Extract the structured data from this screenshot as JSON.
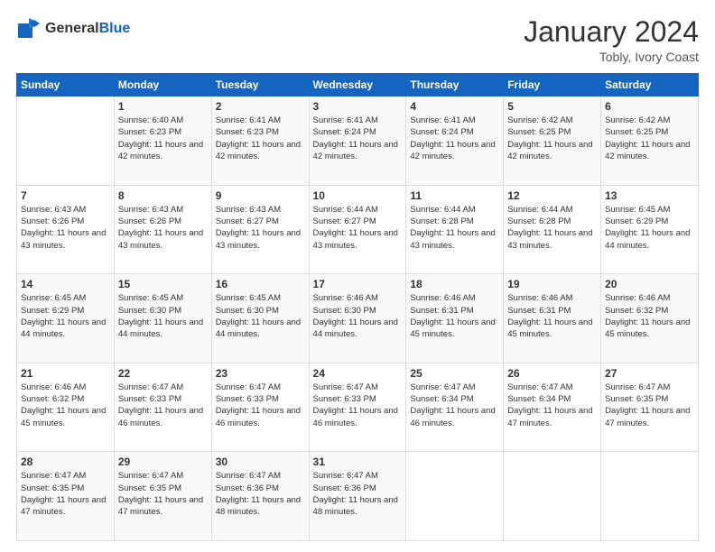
{
  "header": {
    "logo_general": "General",
    "logo_blue": "Blue",
    "month_title": "January 2024",
    "location": "Tobly, Ivory Coast"
  },
  "weekdays": [
    "Sunday",
    "Monday",
    "Tuesday",
    "Wednesday",
    "Thursday",
    "Friday",
    "Saturday"
  ],
  "weeks": [
    [
      {
        "day": "",
        "sunrise": "",
        "sunset": "",
        "daylight": ""
      },
      {
        "day": "1",
        "sunrise": "6:40 AM",
        "sunset": "6:23 PM",
        "daylight": "11 hours and 42 minutes."
      },
      {
        "day": "2",
        "sunrise": "6:41 AM",
        "sunset": "6:23 PM",
        "daylight": "11 hours and 42 minutes."
      },
      {
        "day": "3",
        "sunrise": "6:41 AM",
        "sunset": "6:24 PM",
        "daylight": "11 hours and 42 minutes."
      },
      {
        "day": "4",
        "sunrise": "6:41 AM",
        "sunset": "6:24 PM",
        "daylight": "11 hours and 42 minutes."
      },
      {
        "day": "5",
        "sunrise": "6:42 AM",
        "sunset": "6:25 PM",
        "daylight": "11 hours and 42 minutes."
      },
      {
        "day": "6",
        "sunrise": "6:42 AM",
        "sunset": "6:25 PM",
        "daylight": "11 hours and 42 minutes."
      }
    ],
    [
      {
        "day": "7",
        "sunrise": "6:43 AM",
        "sunset": "6:26 PM",
        "daylight": "11 hours and 43 minutes."
      },
      {
        "day": "8",
        "sunrise": "6:43 AM",
        "sunset": "6:26 PM",
        "daylight": "11 hours and 43 minutes."
      },
      {
        "day": "9",
        "sunrise": "6:43 AM",
        "sunset": "6:27 PM",
        "daylight": "11 hours and 43 minutes."
      },
      {
        "day": "10",
        "sunrise": "6:44 AM",
        "sunset": "6:27 PM",
        "daylight": "11 hours and 43 minutes."
      },
      {
        "day": "11",
        "sunrise": "6:44 AM",
        "sunset": "6:28 PM",
        "daylight": "11 hours and 43 minutes."
      },
      {
        "day": "12",
        "sunrise": "6:44 AM",
        "sunset": "6:28 PM",
        "daylight": "11 hours and 43 minutes."
      },
      {
        "day": "13",
        "sunrise": "6:45 AM",
        "sunset": "6:29 PM",
        "daylight": "11 hours and 44 minutes."
      }
    ],
    [
      {
        "day": "14",
        "sunrise": "6:45 AM",
        "sunset": "6:29 PM",
        "daylight": "11 hours and 44 minutes."
      },
      {
        "day": "15",
        "sunrise": "6:45 AM",
        "sunset": "6:30 PM",
        "daylight": "11 hours and 44 minutes."
      },
      {
        "day": "16",
        "sunrise": "6:45 AM",
        "sunset": "6:30 PM",
        "daylight": "11 hours and 44 minutes."
      },
      {
        "day": "17",
        "sunrise": "6:46 AM",
        "sunset": "6:30 PM",
        "daylight": "11 hours and 44 minutes."
      },
      {
        "day": "18",
        "sunrise": "6:46 AM",
        "sunset": "6:31 PM",
        "daylight": "11 hours and 45 minutes."
      },
      {
        "day": "19",
        "sunrise": "6:46 AM",
        "sunset": "6:31 PM",
        "daylight": "11 hours and 45 minutes."
      },
      {
        "day": "20",
        "sunrise": "6:46 AM",
        "sunset": "6:32 PM",
        "daylight": "11 hours and 45 minutes."
      }
    ],
    [
      {
        "day": "21",
        "sunrise": "6:46 AM",
        "sunset": "6:32 PM",
        "daylight": "11 hours and 45 minutes."
      },
      {
        "day": "22",
        "sunrise": "6:47 AM",
        "sunset": "6:33 PM",
        "daylight": "11 hours and 46 minutes."
      },
      {
        "day": "23",
        "sunrise": "6:47 AM",
        "sunset": "6:33 PM",
        "daylight": "11 hours and 46 minutes."
      },
      {
        "day": "24",
        "sunrise": "6:47 AM",
        "sunset": "6:33 PM",
        "daylight": "11 hours and 46 minutes."
      },
      {
        "day": "25",
        "sunrise": "6:47 AM",
        "sunset": "6:34 PM",
        "daylight": "11 hours and 46 minutes."
      },
      {
        "day": "26",
        "sunrise": "6:47 AM",
        "sunset": "6:34 PM",
        "daylight": "11 hours and 47 minutes."
      },
      {
        "day": "27",
        "sunrise": "6:47 AM",
        "sunset": "6:35 PM",
        "daylight": "11 hours and 47 minutes."
      }
    ],
    [
      {
        "day": "28",
        "sunrise": "6:47 AM",
        "sunset": "6:35 PM",
        "daylight": "11 hours and 47 minutes."
      },
      {
        "day": "29",
        "sunrise": "6:47 AM",
        "sunset": "6:35 PM",
        "daylight": "11 hours and 47 minutes."
      },
      {
        "day": "30",
        "sunrise": "6:47 AM",
        "sunset": "6:36 PM",
        "daylight": "11 hours and 48 minutes."
      },
      {
        "day": "31",
        "sunrise": "6:47 AM",
        "sunset": "6:36 PM",
        "daylight": "11 hours and 48 minutes."
      },
      {
        "day": "",
        "sunrise": "",
        "sunset": "",
        "daylight": ""
      },
      {
        "day": "",
        "sunrise": "",
        "sunset": "",
        "daylight": ""
      },
      {
        "day": "",
        "sunrise": "",
        "sunset": "",
        "daylight": ""
      }
    ]
  ],
  "labels": {
    "sunrise": "Sunrise:",
    "sunset": "Sunset:",
    "daylight": "Daylight:"
  }
}
